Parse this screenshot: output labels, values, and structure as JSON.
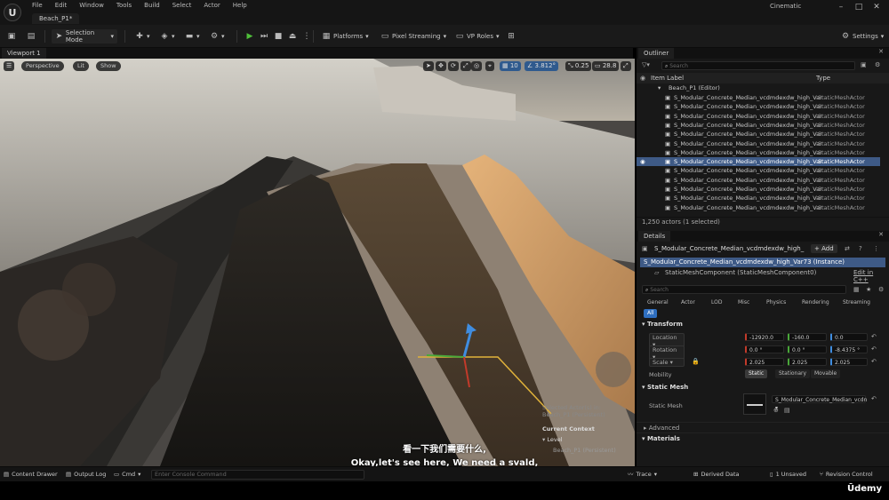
{
  "app": {
    "project_tab": "Beach_P1*",
    "menus": [
      "File",
      "Edit",
      "Window",
      "Tools",
      "Build",
      "Select",
      "Actor",
      "Help"
    ],
    "cinematic": "Cinematic"
  },
  "toolbar": {
    "selection_mode": "Selection Mode",
    "platforms": "Platforms",
    "pixel_streaming": "Pixel Streaming",
    "vp_roles": "VP Roles",
    "settings": "Settings"
  },
  "viewport": {
    "tab": "Viewport 1",
    "perspective": "Perspective",
    "lit": "Lit",
    "show": "Show",
    "grid": "10",
    "angle": "3.812°",
    "scale": "0.25",
    "cam": "28.8"
  },
  "level_panel": {
    "selected": "Selected Actor(s) in:",
    "sel_level": "Beach_P1 (Persistent)",
    "context": "Current Context",
    "level": "Level",
    "level_name": "Beach_P1 (Persistent)"
  },
  "subtitles": {
    "cn": "看一下我们需要什么,",
    "en": "Okay,let's see here, We need a svald,"
  },
  "outliner": {
    "tab": "Outliner",
    "search": "Search",
    "col_label": "Item Label",
    "col_type": "Type",
    "root": "Beach_P1 (Editor)",
    "items": [
      {
        "n": "S_Modular_Concrete_Median_vcdmdexdw_high_Var",
        "t": "StaticMeshActor"
      },
      {
        "n": "S_Modular_Concrete_Median_vcdmdexdw_high_Var",
        "t": "StaticMeshActor"
      },
      {
        "n": "S_Modular_Concrete_Median_vcdmdexdw_high_Var",
        "t": "StaticMeshActor"
      },
      {
        "n": "S_Modular_Concrete_Median_vcdmdexdw_high_Var",
        "t": "StaticMeshActor"
      },
      {
        "n": "S_Modular_Concrete_Median_vcdmdexdw_high_Var",
        "t": "StaticMeshActor"
      },
      {
        "n": "S_Modular_Concrete_Median_vcdmdexdw_high_Var",
        "t": "StaticMeshActor"
      },
      {
        "n": "S_Modular_Concrete_Median_vcdmdexdw_high_Var",
        "t": "StaticMeshActor"
      },
      {
        "n": "S_Modular_Concrete_Median_vcdmdexdw_high_Var",
        "t": "StaticMeshActor"
      },
      {
        "n": "S_Modular_Concrete_Median_vcdmdexdw_high_Var",
        "t": "StaticMeshActor"
      },
      {
        "n": "S_Modular_Concrete_Median_vcdmdexdw_high_Var",
        "t": "StaticMeshActor"
      },
      {
        "n": "S_Modular_Concrete_Median_vcdmdexdw_high_Var",
        "t": "StaticMeshActor"
      },
      {
        "n": "S_Modular_Concrete_Median_vcdmdexdw_high_Var",
        "t": "StaticMeshActor"
      },
      {
        "n": "S_Modular_Concrete_Median_vcdmdexdw_high_Var",
        "t": "StaticMeshActor"
      }
    ],
    "count": "1,250 actors (1 selected)"
  },
  "details": {
    "tab": "Details",
    "actor_name": "S_Modular_Concrete_Median_vcdmdexdw_high_",
    "add": "+ Add",
    "instance": "S_Modular_Concrete_Median_vcdmdexdw_high_Var73 (Instance)",
    "component": "StaticMeshComponent (StaticMeshComponent0)",
    "edit_cpp": "Edit in C++",
    "search": "Search",
    "filters": [
      "General",
      "Actor",
      "LOD",
      "Misc",
      "Physics",
      "Rendering",
      "Streaming"
    ],
    "all": "All",
    "transform": "Transform",
    "location": "Location",
    "rotation": "Rotation",
    "scale": "Scale",
    "loc": [
      "-12920.0",
      "-160.0",
      "0.0"
    ],
    "rot": [
      "0.0 °",
      "0.0 °",
      "-8.4375 °"
    ],
    "scl": [
      "2.025",
      "2.025",
      "2.025"
    ],
    "mobility": "Mobility",
    "mob_opts": [
      "Static",
      "Stationary",
      "Movable"
    ],
    "static_mesh_section": "Static Mesh",
    "static_mesh_label": "Static Mesh",
    "mesh_value": "S_Modular_Concrete_Median_vcdn",
    "advanced": "Advanced",
    "materials": "Materials"
  },
  "statusbar": {
    "content_drawer": "Content Drawer",
    "output_log": "Output Log",
    "cmd": "Cmd",
    "console": "Enter Console Command",
    "trace": "Trace",
    "derived": "Derived Data",
    "unsaved": "1 Unsaved",
    "revision": "Revision Control"
  },
  "brand": "Ūdemy"
}
